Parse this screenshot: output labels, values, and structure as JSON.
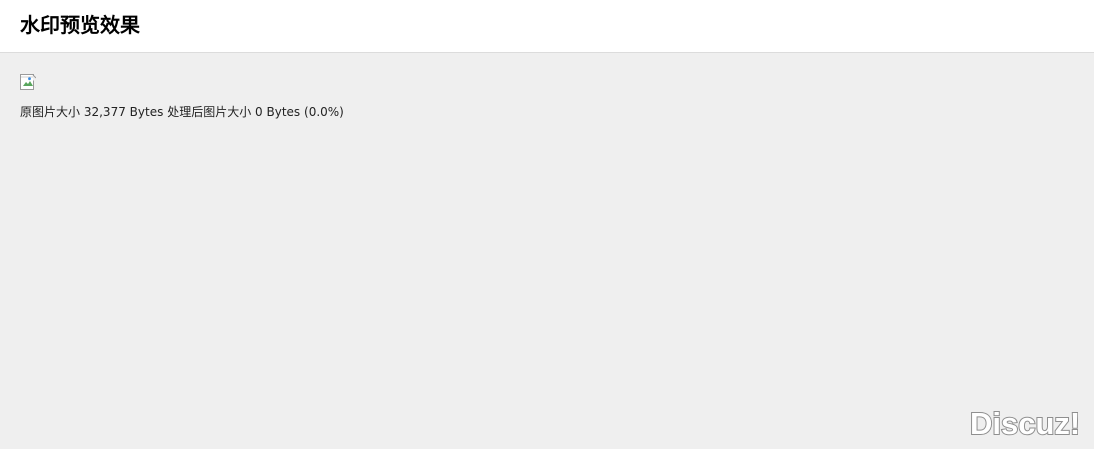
{
  "header": {
    "title": "水印预览效果"
  },
  "preview": {
    "image_icon": "broken-image-icon",
    "original_size_label": "原图片大小",
    "original_size_value": "32,377",
    "original_size_unit": "Bytes",
    "processed_size_label": "处理后图片大小",
    "processed_size_value": "0",
    "processed_size_unit": "Bytes",
    "processed_ratio": "(0.0%)"
  },
  "watermark": {
    "text": "Discuz!",
    "fill_color": "#ffffff",
    "stroke_color": "#8f8f8f"
  },
  "colors": {
    "background": "#efefef",
    "header_background": "#ffffff",
    "header_border": "#dcdcdc"
  }
}
